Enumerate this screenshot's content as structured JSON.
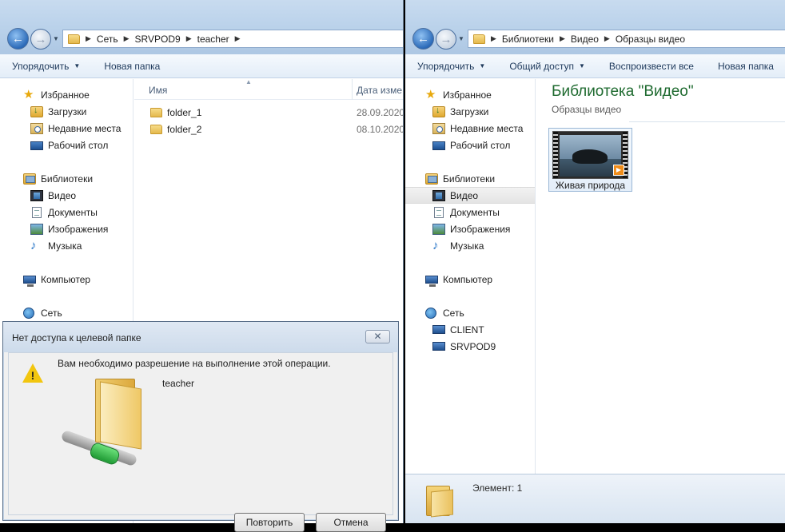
{
  "left_window": {
    "address": [
      "Сеть",
      "SRVPOD9",
      "teacher"
    ],
    "toolbar": {
      "organize": "Упорядочить",
      "new_folder": "Новая папка"
    },
    "nav": {
      "favorites": "Избранное",
      "downloads": "Загрузки",
      "recent": "Недавние места",
      "desktop": "Рабочий стол",
      "libraries": "Библиотеки",
      "video": "Видео",
      "documents": "Документы",
      "images": "Изображения",
      "music": "Музыка",
      "computer": "Компьютер",
      "network": "Сеть"
    },
    "columns": {
      "name": "Имя",
      "date": "Дата изме"
    },
    "files": [
      {
        "name": "folder_1",
        "date": "28.09.2020"
      },
      {
        "name": "folder_2",
        "date": "08.10.2020"
      }
    ]
  },
  "right_window": {
    "address": [
      "Библиотеки",
      "Видео",
      "Образцы видео"
    ],
    "toolbar": {
      "organize": "Упорядочить",
      "share": "Общий доступ",
      "play_all": "Воспроизвести все",
      "new_folder": "Новая папка"
    },
    "nav": {
      "favorites": "Избранное",
      "downloads": "Загрузки",
      "recent": "Недавние места",
      "desktop": "Рабочий стол",
      "libraries": "Библиотеки",
      "video": "Видео",
      "documents": "Документы",
      "images": "Изображения",
      "music": "Музыка",
      "computer": "Компьютер",
      "network": "Сеть",
      "client": "CLIENT",
      "srvpod9": "SRVPOD9"
    },
    "library_title": "Библиотека \"Видео\"",
    "library_subtitle": "Образцы видео",
    "tile_caption": "Живая природа",
    "status": "Элемент: 1"
  },
  "dialog": {
    "title": "Нет доступа к целевой папке",
    "close": "✕",
    "message": "Вам необходимо разрешение на выполнение этой операции.",
    "item": "teacher",
    "retry": "Повторить",
    "cancel": "Отмена"
  },
  "colors": {
    "accent_green": "#1e6a2f",
    "chrome": "#c8dbef",
    "toolbar_text": "#1e395b"
  }
}
